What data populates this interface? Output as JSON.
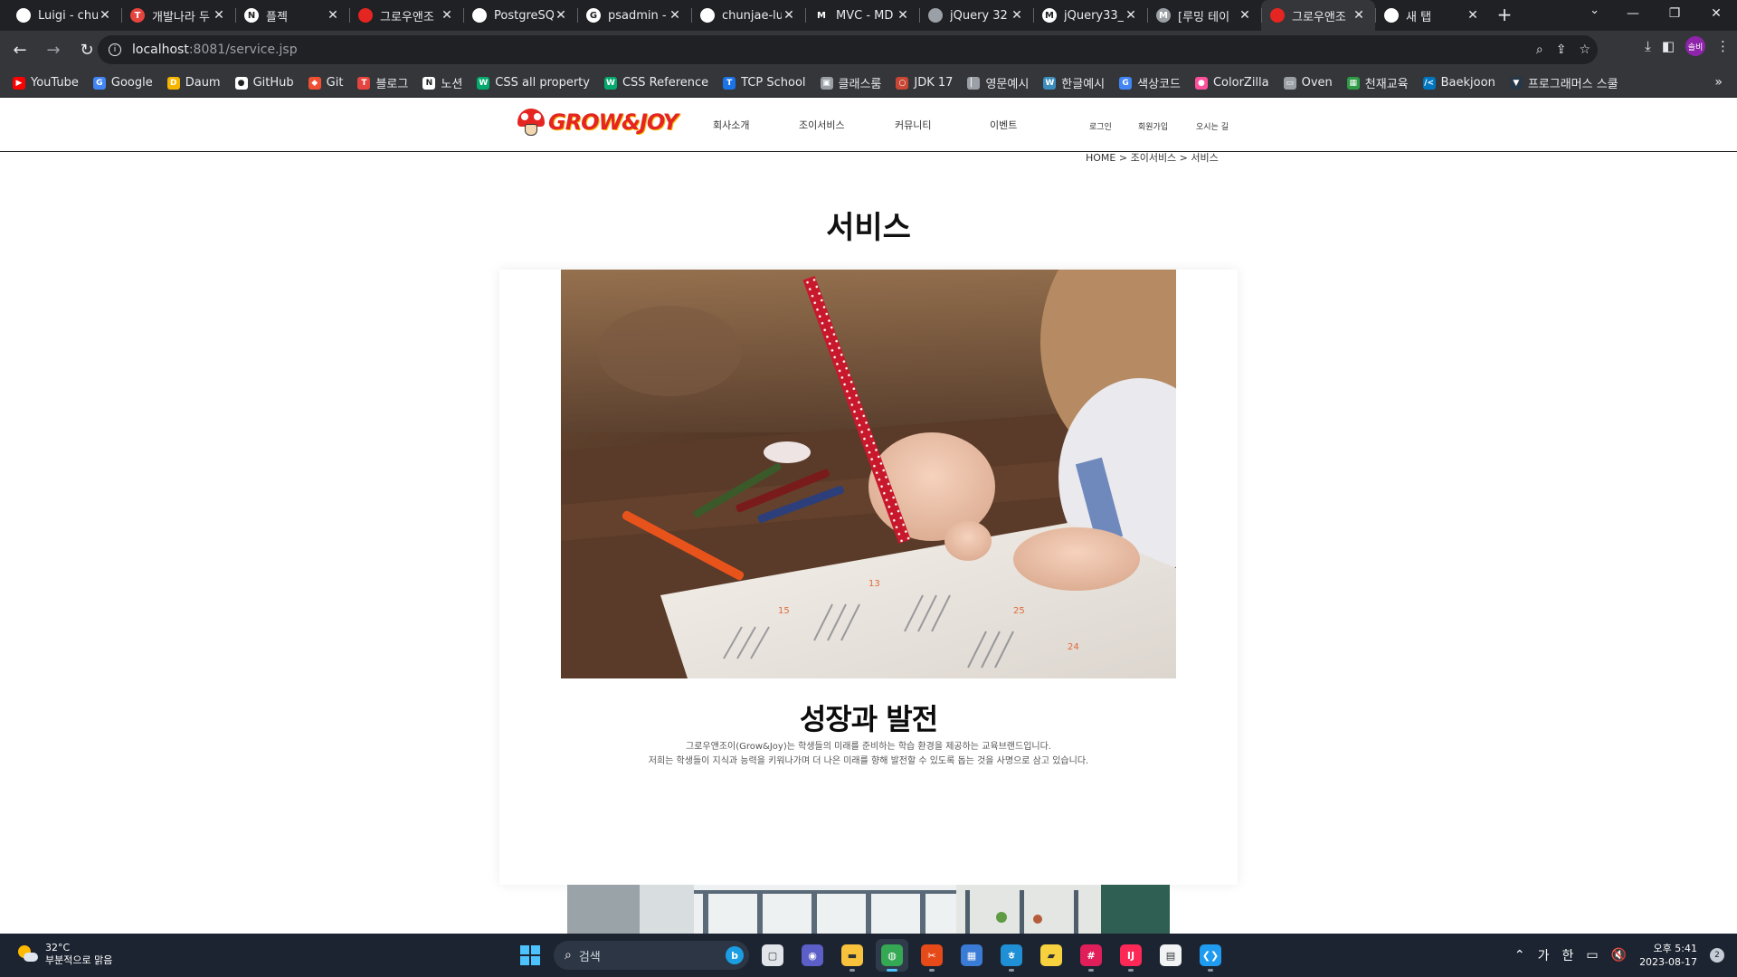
{
  "browser": {
    "tabs": [
      {
        "title": "Luigi - chun",
        "icon": "github-icon",
        "color": "#ffffff",
        "glyph": ""
      },
      {
        "title": "개발나라 두",
        "icon": "tistory-icon",
        "color": "#e6443e",
        "glyph": "T"
      },
      {
        "title": "플젝",
        "icon": "notion-icon",
        "color": "#ffffff",
        "glyph": "N"
      },
      {
        "title": "그로우앤조",
        "icon": "mushroom-icon",
        "color": "#e52521",
        "glyph": ""
      },
      {
        "title": "PostgreSQL",
        "icon": "panda-icon",
        "color": "#ffffff",
        "glyph": ""
      },
      {
        "title": "psadmin -",
        "icon": "google-icon",
        "color": "#ffffff",
        "glyph": "G"
      },
      {
        "title": "chunjae-lui",
        "icon": "github-icon",
        "color": "#ffffff",
        "glyph": ""
      },
      {
        "title": "MVC - MD",
        "icon": "mdn-icon",
        "color": "#202124",
        "glyph": "M"
      },
      {
        "title": "jQuery 32",
        "icon": "globe-icon",
        "color": "#9aa0a6",
        "glyph": ""
      },
      {
        "title": "jQuery33_c",
        "icon": "gmail-icon",
        "color": "#ffffff",
        "glyph": "M"
      },
      {
        "title": "[루밍 테이",
        "icon": "document-icon",
        "color": "#9aa0a6",
        "glyph": "M"
      },
      {
        "title": "그로우앤조",
        "icon": "mushroom-icon",
        "color": "#e52521",
        "glyph": "",
        "active": true
      },
      {
        "title": "새 탭",
        "icon": "chrome-icon",
        "color": "#ffffff",
        "glyph": ""
      }
    ],
    "address": {
      "host": "localhost",
      "path": ":8081/service.jsp"
    },
    "profile_initials": "솔비",
    "bookmarks": [
      {
        "label": "YouTube",
        "icon": "youtube-icon",
        "color": "#ff0000",
        "glyph": "▶"
      },
      {
        "label": "Google",
        "icon": "google-icon",
        "color": "#4285f4",
        "glyph": "G"
      },
      {
        "label": "Daum",
        "icon": "daum-icon",
        "color": "#f7b500",
        "glyph": "D"
      },
      {
        "label": "GitHub",
        "icon": "github-icon",
        "color": "#ffffff",
        "glyph": "●"
      },
      {
        "label": "Git",
        "icon": "git-icon",
        "color": "#f05033",
        "glyph": "◆"
      },
      {
        "label": "블로그",
        "icon": "tistory-icon",
        "color": "#e6443e",
        "glyph": "T"
      },
      {
        "label": "노션",
        "icon": "notion-icon",
        "color": "#ffffff",
        "glyph": "N"
      },
      {
        "label": "CSS all property",
        "icon": "w3schools-icon",
        "color": "#04aa6d",
        "glyph": "W"
      },
      {
        "label": "CSS Reference",
        "icon": "w3schools-icon",
        "color": "#04aa6d",
        "glyph": "W"
      },
      {
        "label": "TCP School",
        "icon": "tcpschool-icon",
        "color": "#1a73e8",
        "glyph": "T"
      },
      {
        "label": "클래스룸",
        "icon": "classroom-icon",
        "color": "#9aa0a6",
        "glyph": "▣"
      },
      {
        "label": "JDK 17",
        "icon": "oracle-icon",
        "color": "#c74634",
        "glyph": "○"
      },
      {
        "label": "영문예시",
        "icon": "page-icon",
        "color": "#9aa0a6",
        "glyph": "▏"
      },
      {
        "label": "한글예시",
        "icon": "wordpress-icon",
        "color": "#3c8dbc",
        "glyph": "W"
      },
      {
        "label": "색상코드",
        "icon": "google-icon",
        "color": "#4285f4",
        "glyph": "G"
      },
      {
        "label": "ColorZilla",
        "icon": "colorzilla-icon",
        "color": "#ff4f9a",
        "glyph": "●"
      },
      {
        "label": "Oven",
        "icon": "oven-icon",
        "color": "#9aa0a6",
        "glyph": "▭"
      },
      {
        "label": "천재교육",
        "icon": "chunjae-icon",
        "color": "#2e9b46",
        "glyph": "▦"
      },
      {
        "label": "Baekjoon",
        "icon": "baekjoon-icon",
        "color": "#0076c0",
        "glyph": "/<"
      },
      {
        "label": "프로그래머스 스쿨",
        "icon": "programmers-icon",
        "color": "#263747",
        "glyph": "▼"
      }
    ]
  },
  "site": {
    "logo_text": "GROW&JOY",
    "nav": [
      "회사소개",
      "조이서비스",
      "커뮤니티",
      "이벤트"
    ],
    "util": [
      "로그인",
      "회원가입",
      "오시는 길"
    ],
    "breadcrumb": "HOME > 조이서비스 > 서비스",
    "page_title": "서비스",
    "card": {
      "heading": "성장과 발전",
      "desc_line1": "그로우앤조이(Grow&Joy)는 학생들의 미래를 준비하는 학습 환경을 제공하는 교육브랜드입니다.",
      "desc_line2": "저희는 학생들이 지식과 능력을 키워나가며 더 나은 미래를 향해 발전할 수 있도록 돕는 것을 사명으로 삼고 있습니다."
    }
  },
  "taskbar": {
    "weather_temp": "32°C",
    "weather_desc": "부분적으로 맑음",
    "search_placeholder": "검색",
    "apps": [
      {
        "name": "task-view-icon",
        "color": "#e1e5ea",
        "glyph": "▢"
      },
      {
        "name": "teams-icon",
        "color": "#5b5fc7",
        "glyph": "◉"
      },
      {
        "name": "file-explorer-icon",
        "color": "#f9c23c",
        "glyph": "▬",
        "state": "running"
      },
      {
        "name": "chrome-icon",
        "color": "#34a853",
        "glyph": "◍",
        "state": "active"
      },
      {
        "name": "snipping-tool-icon",
        "color": "#e64a19",
        "glyph": "✂",
        "state": "running"
      },
      {
        "name": "microsoft-store-icon",
        "color": "#3a7bd5",
        "glyph": "▦"
      },
      {
        "name": "hangul-icon",
        "color": "#1f8fd6",
        "glyph": "ㅎ",
        "state": "running"
      },
      {
        "name": "sticky-notes-icon",
        "color": "#f7d23e",
        "glyph": "▰"
      },
      {
        "name": "slack-icon",
        "color": "#e01e5a",
        "glyph": "#",
        "state": "running"
      },
      {
        "name": "intellij-icon",
        "color": "#fe2857",
        "glyph": "IJ",
        "state": "running"
      },
      {
        "name": "notepad-icon",
        "color": "#f1f3f5",
        "glyph": "▤"
      },
      {
        "name": "vscode-icon",
        "color": "#1f9cf0",
        "glyph": "❮❯",
        "state": "running"
      }
    ],
    "ime_lang": "가",
    "ime_mode": "한",
    "time": "오후 5:41",
    "date": "2023-08-17",
    "notifications": "2"
  }
}
